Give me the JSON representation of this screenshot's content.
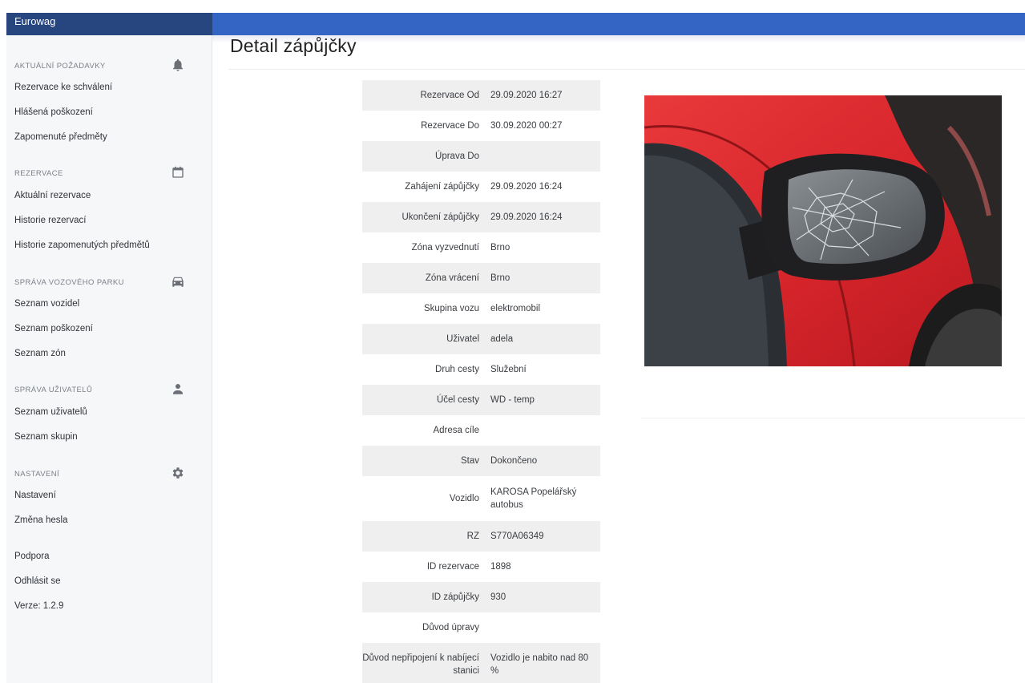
{
  "app": {
    "brand": "Eurowag"
  },
  "sidebar": {
    "sections": [
      {
        "heading": "AKTUÁLNÍ POŽADAVKY",
        "icon": "bell-icon",
        "items": [
          "Rezervace ke schválení",
          "Hlášená poškození",
          "Zapomenuté předměty"
        ]
      },
      {
        "heading": "REZERVACE",
        "icon": "calendar-icon",
        "items": [
          "Aktuální rezervace",
          "Historie rezervací",
          "Historie zapomenutých předmětů"
        ]
      },
      {
        "heading": "SPRÁVA VOZOVÉHO PARKU",
        "icon": "car-icon",
        "items": [
          "Seznam vozidel",
          "Seznam poškození",
          "Seznam zón"
        ]
      },
      {
        "heading": "SPRÁVA UŽIVATELŮ",
        "icon": "person-icon",
        "items": [
          "Seznam uživatelů",
          "Seznam skupin"
        ]
      },
      {
        "heading": "NASTAVENÍ",
        "icon": "gear-icon",
        "items": [
          "Nastavení",
          "Změna hesla"
        ]
      }
    ],
    "footer": [
      "Podpora",
      "Odhlásit se",
      "Verze: 1.2.9"
    ]
  },
  "page": {
    "title": "Detail zápůjčky"
  },
  "details": [
    {
      "label": "Rezervace Od",
      "value": "29.09.2020 16:27"
    },
    {
      "label": "Rezervace Do",
      "value": "30.09.2020 00:27"
    },
    {
      "label": "Úprava Do",
      "value": ""
    },
    {
      "label": "Zahájení zápůjčky",
      "value": "29.09.2020 16:24"
    },
    {
      "label": "Ukončení zápůjčky",
      "value": "29.09.2020 16:24"
    },
    {
      "label": "Zóna vyzvednutí",
      "value": "Brno"
    },
    {
      "label": "Zóna vrácení",
      "value": "Brno"
    },
    {
      "label": "Skupina vozu",
      "value": "elektromobil"
    },
    {
      "label": "Uživatel",
      "value": "adela"
    },
    {
      "label": "Druh cesty",
      "value": "Služební"
    },
    {
      "label": "Účel cesty",
      "value": "WD - temp"
    },
    {
      "label": "Adresa cíle",
      "value": ""
    },
    {
      "label": "Stav",
      "value": "Dokončeno"
    },
    {
      "label": "Vozidlo",
      "value": "KAROSA Popelářský autobus"
    },
    {
      "label": "RZ",
      "value": "S770A06349"
    },
    {
      "label": "ID rezervace",
      "value": "1898"
    },
    {
      "label": "ID zápůjčky",
      "value": "930"
    },
    {
      "label": "Důvod úpravy",
      "value": ""
    },
    {
      "label": "Důvod nepřipojení k nabíjecí stanici",
      "value": "Vozidlo je nabito nad 80 %"
    }
  ],
  "colors": {
    "topbar": "#3464c4",
    "brandbar": "#27457f",
    "status_ok": "#3aa14a",
    "car": "#d8262c"
  }
}
